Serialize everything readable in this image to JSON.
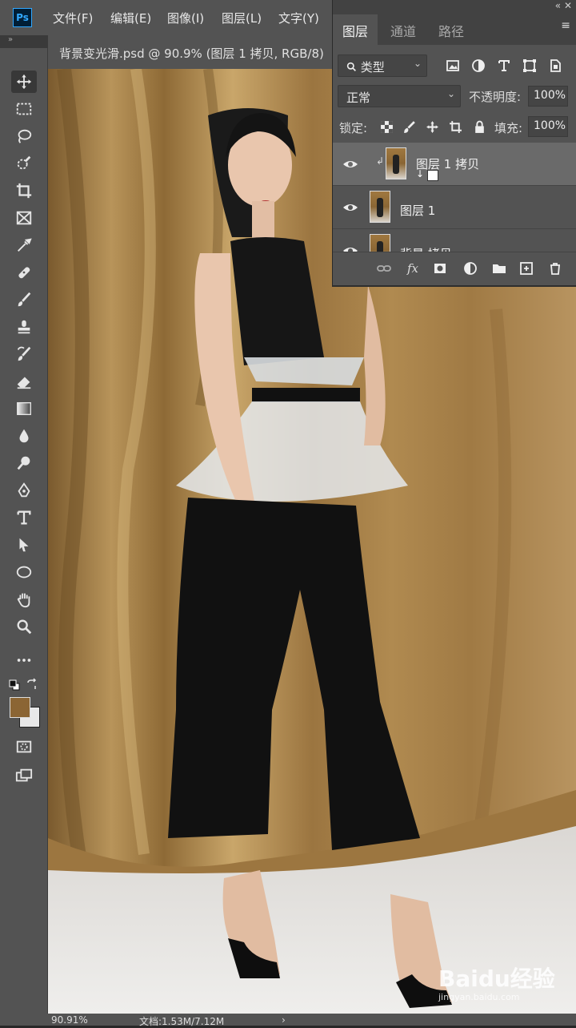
{
  "app": {
    "logo": "Ps"
  },
  "menu": [
    "文件(F)",
    "编辑(E)",
    "图像(I)",
    "图层(L)",
    "文字(Y)"
  ],
  "document_tab": {
    "title": "背景变光滑.psd @ 90.9% (图层 1 拷贝, RGB/8)"
  },
  "tools": [
    "move-icon",
    "marquee-icon",
    "lasso-icon",
    "quick-select-icon",
    "crop-icon",
    "frame-icon",
    "eyedropper-icon",
    "healing-brush-icon",
    "brush-icon",
    "clone-stamp-icon",
    "history-brush-icon",
    "eraser-icon",
    "gradient-icon",
    "blur-icon",
    "dodge-icon",
    "pen-icon",
    "type-icon",
    "path-select-icon",
    "ellipse-icon",
    "hand-icon",
    "zoom-icon",
    "more-icon"
  ],
  "colors": {
    "foreground": "#8b6534",
    "background": "#e8e8e8",
    "accent": "#31a8ff"
  },
  "layers_panel": {
    "tabs": [
      "图层",
      "通道",
      "路径"
    ],
    "filter": {
      "label": "类型"
    },
    "blend_mode": "正常",
    "opacity_label": "不透明度:",
    "opacity_value": "100%",
    "lock_label": "锁定:",
    "fill_label": "填充:",
    "fill_value": "100%",
    "layers": [
      {
        "name": "图层 1 拷贝",
        "visible": true,
        "selected": true
      },
      {
        "name": "图层 1",
        "visible": true,
        "selected": false
      },
      {
        "name": "背景 拷贝",
        "visible": true,
        "selected": false
      }
    ]
  },
  "status": {
    "zoom": "90.91%",
    "doc_info": "文档:1.53M/7.12M"
  },
  "watermark": {
    "brand": "Baidu经验",
    "url": "jingyan.baidu.com"
  }
}
